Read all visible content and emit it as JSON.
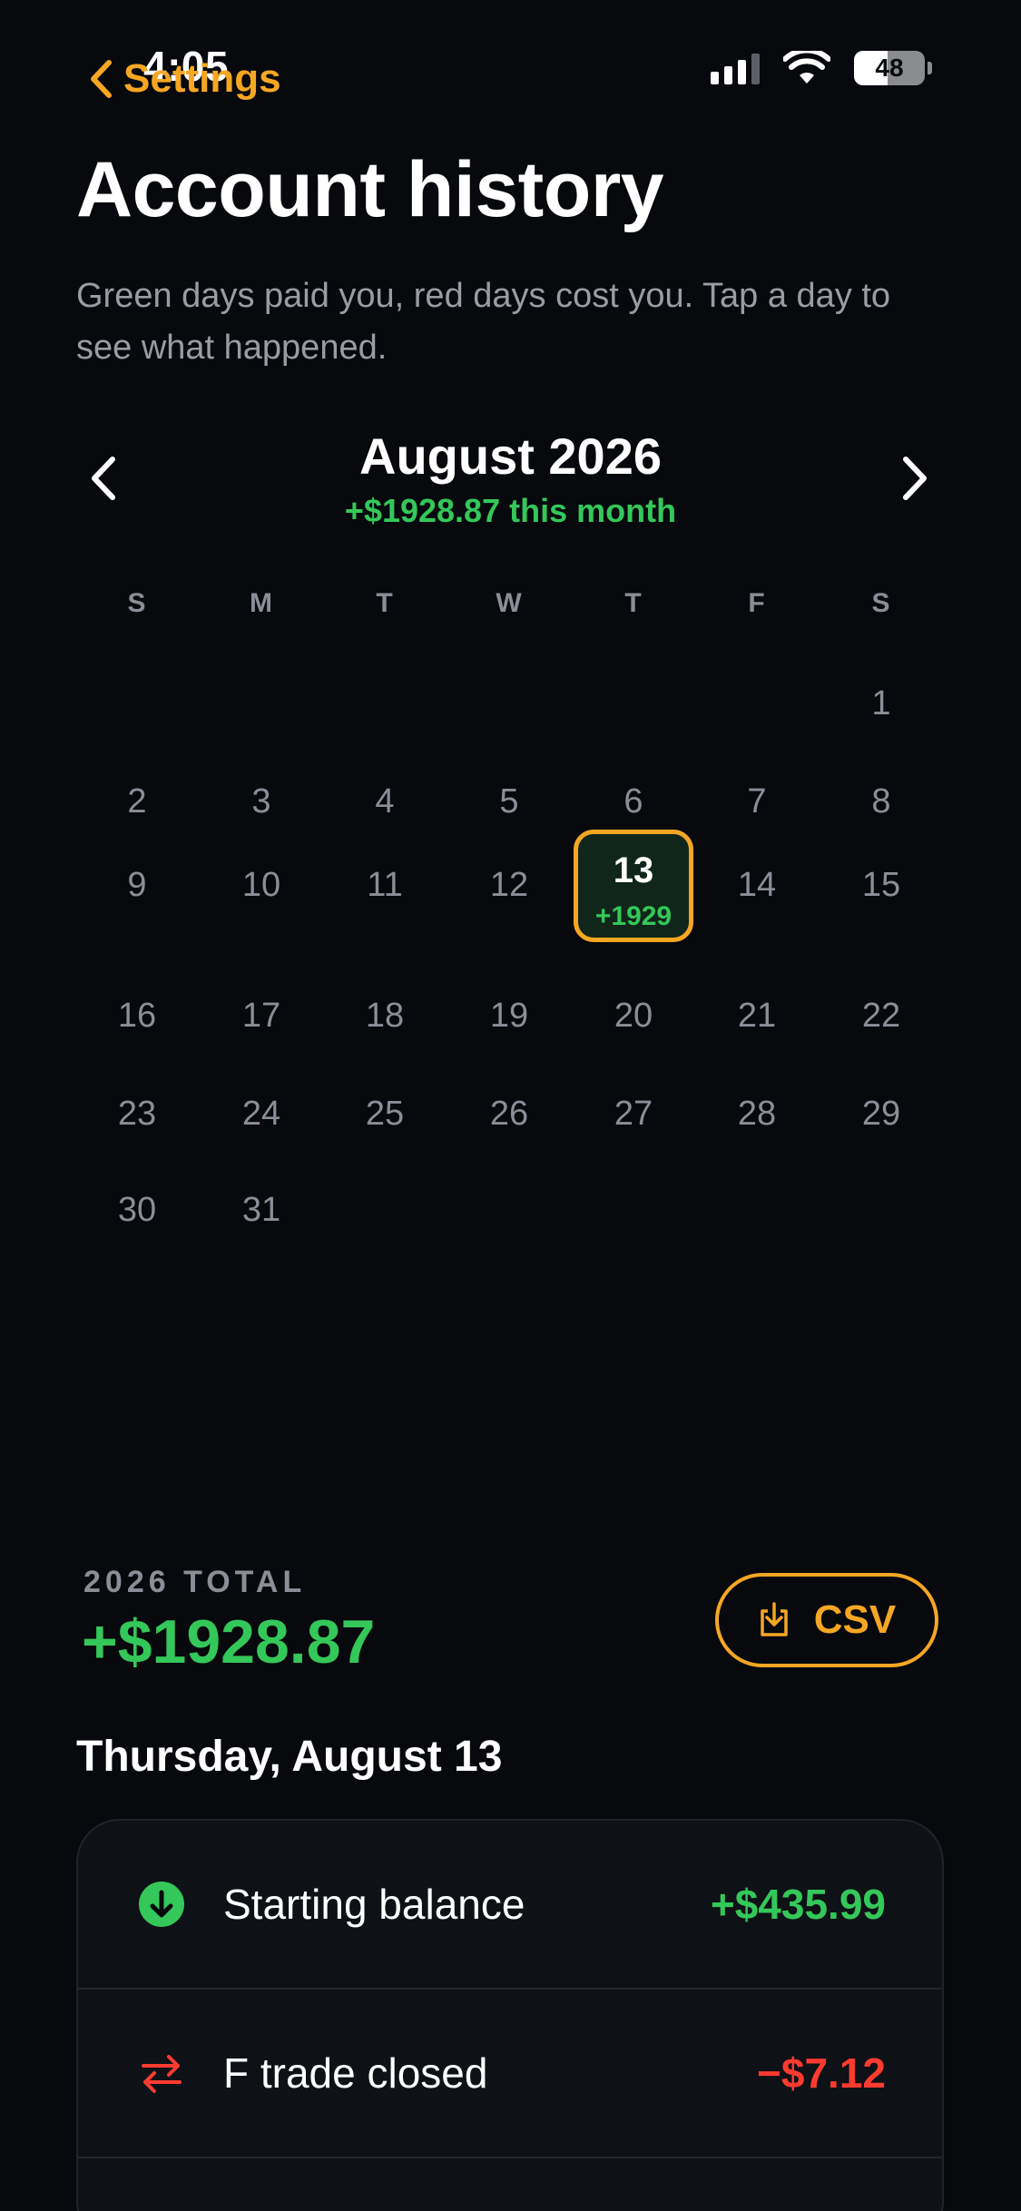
{
  "status": {
    "time": "4:05",
    "battery": "48",
    "battery_level": 0.48
  },
  "nav": {
    "back_label": "Settings"
  },
  "page": {
    "title": "Account history",
    "subtitle": "Green days paid you, red days cost you. Tap a day to see what happened."
  },
  "calendar": {
    "month": "August 2026",
    "month_summary": "+$1928.87 this month",
    "weekdays": [
      "S",
      "M",
      "T",
      "W",
      "T",
      "F",
      "S"
    ],
    "days": [
      "1",
      "2",
      "3",
      "4",
      "5",
      "6",
      "7",
      "8",
      "9",
      "10",
      "11",
      "12",
      "13",
      "14",
      "15",
      "16",
      "17",
      "18",
      "19",
      "20",
      "21",
      "22",
      "23",
      "24",
      "25",
      "26",
      "27",
      "28",
      "29",
      "30",
      "31"
    ],
    "selected_day": "13",
    "selected_amount": "+1929"
  },
  "total": {
    "label": "2026 TOTAL",
    "value": "+$1928.87",
    "csv_label": "CSV"
  },
  "day_detail": {
    "heading": "Thursday, August 13",
    "rows": [
      {
        "label": "Starting balance",
        "amount": "+$435.99",
        "icon": "arrow-down-circle-icon"
      },
      {
        "label": "F trade closed",
        "amount": "−$7.12",
        "icon": "swap-arrows-icon"
      }
    ]
  },
  "colors": {
    "accent": "#f5a623",
    "positive": "#34c759",
    "negative": "#ff3b30",
    "background": "#07090d"
  }
}
